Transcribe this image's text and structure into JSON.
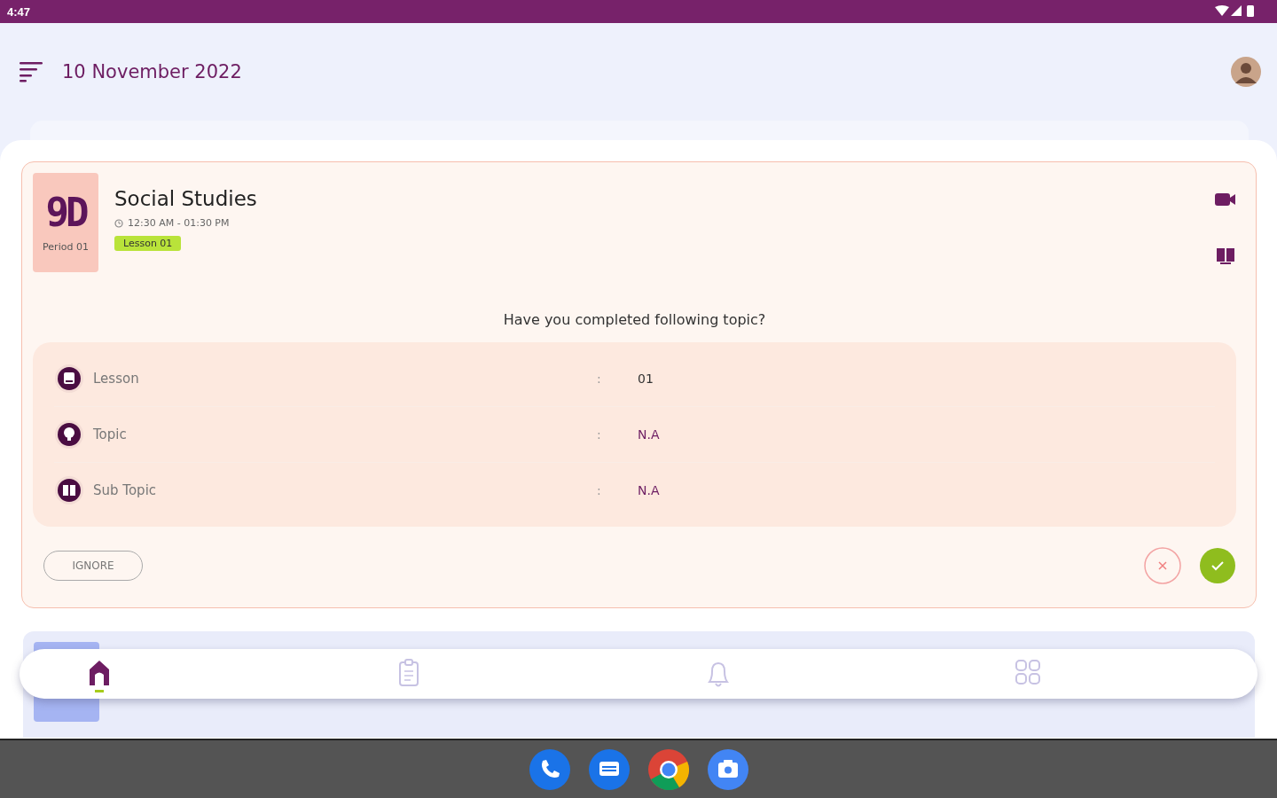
{
  "status_bar": {
    "time": "4:47"
  },
  "header": {
    "date": "10 November 2022"
  },
  "class_card": {
    "period_number": "9D",
    "period_label": "Period 01",
    "subject": "Social Studies",
    "time": "12:30 AM - 01:30 PM",
    "lesson_tag": "Lesson 01",
    "question": "Have you completed following topic?",
    "details": [
      {
        "kind": "lesson",
        "label": "Lesson",
        "separator": ":",
        "value": "01"
      },
      {
        "kind": "topic",
        "label": "Topic",
        "separator": ":",
        "value": "N.A"
      },
      {
        "kind": "subtopic",
        "label": "Sub Topic",
        "separator": ":",
        "value": "N.A"
      }
    ],
    "ignore_button": "IGNORE"
  },
  "bottom_nav": [
    {
      "kind": "home",
      "selected": true
    },
    {
      "kind": "clipboard",
      "selected": false
    },
    {
      "kind": "bell",
      "selected": false
    },
    {
      "kind": "grid",
      "selected": false
    }
  ]
}
